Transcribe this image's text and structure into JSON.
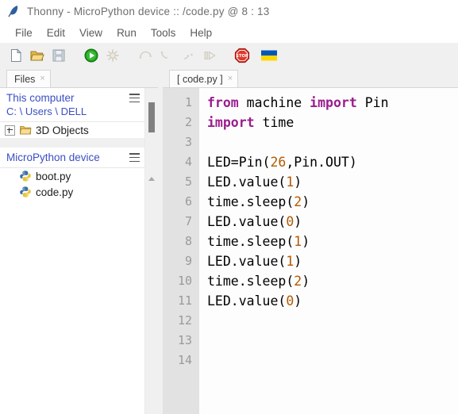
{
  "window": {
    "title": "Thonny  -  MicroPython device :: /code.py  @  8 : 13",
    "app_icon": "feather-icon"
  },
  "menubar": {
    "items": [
      {
        "label": "File"
      },
      {
        "label": "Edit"
      },
      {
        "label": "View"
      },
      {
        "label": "Run"
      },
      {
        "label": "Tools"
      },
      {
        "label": "Help"
      }
    ]
  },
  "toolbar": {
    "buttons": [
      {
        "name": "new-file-icon",
        "enabled": true
      },
      {
        "name": "open-file-icon",
        "enabled": true
      },
      {
        "name": "save-file-icon",
        "enabled": false
      },
      {
        "name": "run-icon",
        "enabled": true
      },
      {
        "name": "debug-icon",
        "enabled": false
      },
      {
        "name": "step-over-icon",
        "enabled": false
      },
      {
        "name": "step-into-icon",
        "enabled": false
      },
      {
        "name": "step-out-icon",
        "enabled": false
      },
      {
        "name": "resume-icon",
        "enabled": false
      },
      {
        "name": "stop-icon",
        "enabled": true,
        "label": "STOP"
      },
      {
        "name": "ukraine-flag-icon",
        "enabled": true
      }
    ]
  },
  "files_panel": {
    "tab": {
      "label": "Files",
      "close": "×"
    },
    "this_computer": {
      "title": "This computer",
      "path": "C: \\ Users \\ DELL",
      "menu_icon": "hamburger-icon",
      "entries": [
        {
          "label": "3D Objects",
          "icon": "folder-icon",
          "expander": "+"
        }
      ]
    },
    "micropython_device": {
      "title": "MicroPython device",
      "menu_icon": "hamburger-icon",
      "entries": [
        {
          "label": "boot.py",
          "icon": "python-file-icon"
        },
        {
          "label": "code.py",
          "icon": "python-file-icon"
        }
      ]
    }
  },
  "editor": {
    "tab": {
      "label": "[ code.py ]",
      "close": "×"
    },
    "line_numbers": [
      "1",
      "2",
      "3",
      "4",
      "5",
      "6",
      "7",
      "8",
      "9",
      "10",
      "11",
      "12",
      "13",
      "14"
    ],
    "lines": [
      [
        {
          "t": "from",
          "c": "kw"
        },
        {
          "t": " machine ",
          "c": "plain"
        },
        {
          "t": "import",
          "c": "kw"
        },
        {
          "t": " Pin",
          "c": "plain"
        }
      ],
      [
        {
          "t": "import",
          "c": "kw"
        },
        {
          "t": " time",
          "c": "plain"
        }
      ],
      [],
      [
        {
          "t": "LED=Pin(",
          "c": "plain"
        },
        {
          "t": "26",
          "c": "num"
        },
        {
          "t": ",Pin.OUT)",
          "c": "plain"
        }
      ],
      [
        {
          "t": "LED.value(",
          "c": "plain"
        },
        {
          "t": "1",
          "c": "num"
        },
        {
          "t": ")",
          "c": "plain"
        }
      ],
      [
        {
          "t": "time.sleep(",
          "c": "plain"
        },
        {
          "t": "2",
          "c": "num"
        },
        {
          "t": ")",
          "c": "plain"
        }
      ],
      [
        {
          "t": "LED.value(",
          "c": "plain"
        },
        {
          "t": "0",
          "c": "num"
        },
        {
          "t": ")",
          "c": "plain"
        }
      ],
      [
        {
          "t": "time.sleep(",
          "c": "plain"
        },
        {
          "t": "1",
          "c": "num"
        },
        {
          "t": ")",
          "c": "plain"
        }
      ],
      [
        {
          "t": "LED.value(",
          "c": "plain"
        },
        {
          "t": "1",
          "c": "num"
        },
        {
          "t": ")",
          "c": "plain"
        }
      ],
      [
        {
          "t": "time.sleep(",
          "c": "plain"
        },
        {
          "t": "2",
          "c": "num"
        },
        {
          "t": ")",
          "c": "plain"
        }
      ],
      [
        {
          "t": "LED.value(",
          "c": "plain"
        },
        {
          "t": "0",
          "c": "num"
        },
        {
          "t": ")",
          "c": "plain"
        }
      ],
      [],
      [],
      []
    ]
  },
  "colors": {
    "keyword": "#9a1d8e",
    "number": "#b35900",
    "tree_label": "#3b4fc4",
    "gutter_bg": "#e2e2e2",
    "gutter_text": "#9a9a9a",
    "chrome_bg": "#f0f0f0",
    "editor_bg": "#fdfdfd",
    "stop_red": "#d42a21",
    "flag_blue": "#0057b7",
    "flag_yellow": "#ffd700",
    "run_green": "#1e9e1e"
  }
}
